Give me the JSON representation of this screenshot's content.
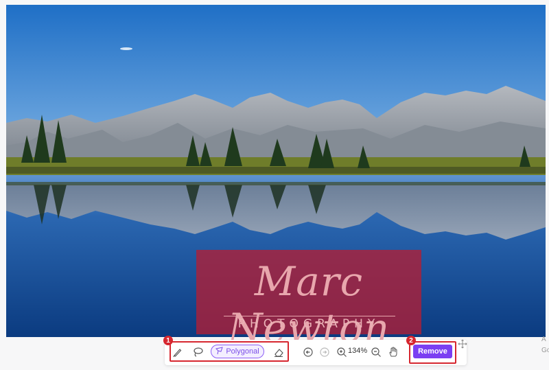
{
  "photo": {
    "description_icon": "photo-canvas",
    "colors": {
      "sky_top": "#1e6fc4",
      "sky_bottom": "#7fb4e3",
      "water_top": "#2d6fb8",
      "water_bottom": "#0d3f84",
      "mountain": "#9aa0a8",
      "grass": "#6f7d2a",
      "trees": "#1f3a1d"
    }
  },
  "watermark": {
    "script_text": "Marc Newton",
    "subtitle": "PHOTOGRAPHY",
    "color": "#b21e34"
  },
  "annotations": {
    "badge_1": "1",
    "badge_2": "2",
    "highlight_color": "#d6262f"
  },
  "toolbar": {
    "brush_icon": "brush-icon",
    "lasso_icon": "lasso-icon",
    "polygonal_label": "Polygonal",
    "polygonal_icon": "polygon-lasso-icon",
    "eraser_icon": "eraser-icon",
    "undo_icon": "undo-icon",
    "redo_icon": "redo-icon",
    "zoom_in_icon": "zoom-in-icon",
    "zoom_value": "134%",
    "zoom_out_icon": "zoom-out-icon",
    "hand_icon": "hand-icon",
    "remove_label": "Remove",
    "remove_color": "#7b3ff2",
    "move_icon": "move-icon"
  },
  "side": {
    "text_a": "A",
    "text_b": "Go"
  }
}
